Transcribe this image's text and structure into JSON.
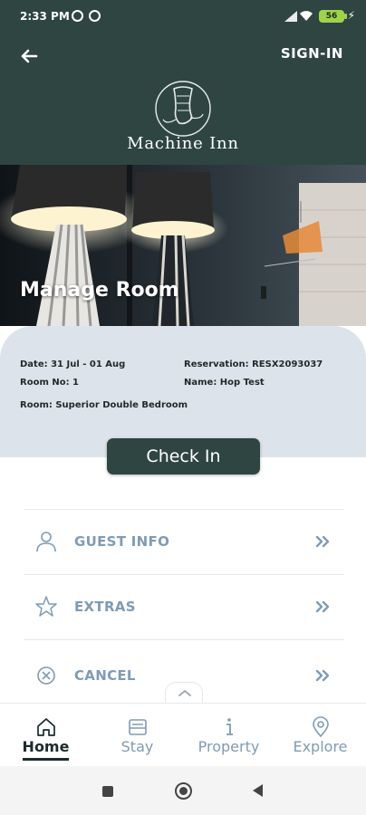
{
  "status_bar": {
    "time": "2:33 PM",
    "battery": "56",
    "icons": [
      "sim-icon",
      "data-saver-icon",
      "signal-icon",
      "wifi-icon",
      "battery-icon",
      "charging-icon"
    ]
  },
  "header": {
    "signin_label": "SIGN-IN",
    "brand_name": "Machine Inn",
    "background_color": "#2f4542"
  },
  "hero": {
    "title": "Manage Room"
  },
  "reservation": {
    "date": "Date: 31 Jul - 01 Aug",
    "reservation": "Reservation: RESX2093037",
    "room_no": "Room No: 1",
    "name": "Name: Hop Test",
    "room": "Room: Superior Double Bedroom"
  },
  "checkin_label": "Check In",
  "menu": [
    {
      "label": "GUEST INFO",
      "icon": "user-icon"
    },
    {
      "label": "EXTRAS",
      "icon": "star-icon"
    },
    {
      "label": "CANCEL",
      "icon": "cancel-circle-icon"
    }
  ],
  "bottom_nav": [
    {
      "label": "Home",
      "icon": "home-icon",
      "active": true
    },
    {
      "label": "Stay",
      "icon": "bed-icon",
      "active": false
    },
    {
      "label": "Property",
      "icon": "info-icon",
      "active": false
    },
    {
      "label": "Explore",
      "icon": "location-pin-icon",
      "active": false
    }
  ],
  "colors": {
    "primary": "#2f4542",
    "menu_text": "#7f9bb5",
    "panel": "#dde3ea"
  }
}
